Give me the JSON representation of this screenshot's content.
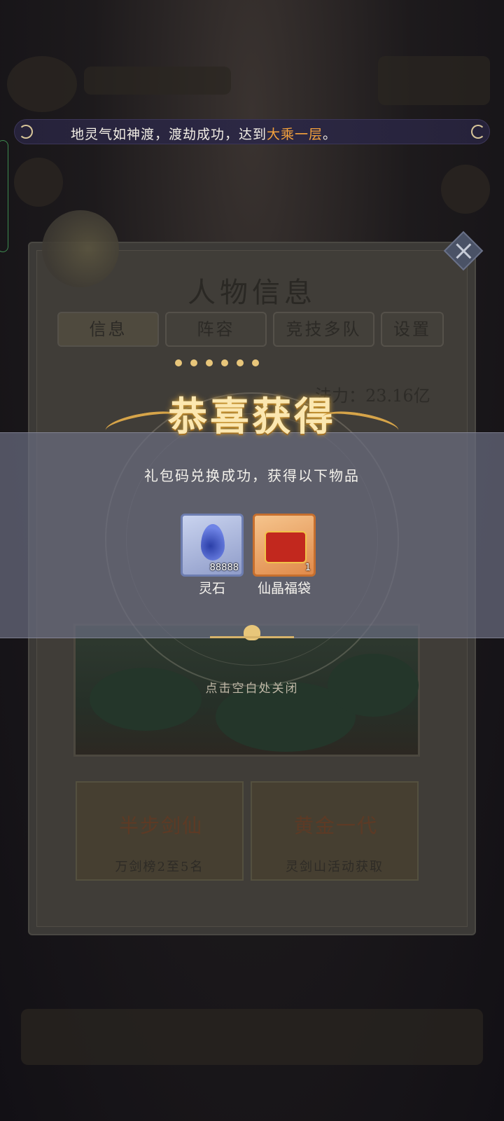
{
  "announcement": {
    "text_before": "地灵气如神渡，渡劫成功，达到",
    "highlight": "大乘一层",
    "text_after": "。",
    "highlight_color": "#f5a23c"
  },
  "panel": {
    "title": "人物信息",
    "tabs": [
      "信息",
      "阵容",
      "竞技多队",
      "设置"
    ],
    "power_label": "法力：23.16亿",
    "cards": [
      {
        "logo": "半步剑仙",
        "caption": "万剑榜2至5名"
      },
      {
        "logo": "黄金一代",
        "caption": "灵剑山活动获取"
      }
    ]
  },
  "reward_popup": {
    "title": "恭喜获得",
    "subtitle": "礼包码兑换成功，获得以下物品",
    "items": [
      {
        "name": "灵石",
        "count": "88888",
        "icon": "spirit-stone-icon"
      },
      {
        "name": "仙晶福袋",
        "count": "1",
        "icon": "lucky-bag-icon"
      }
    ],
    "close_hint": "点击空白处关闭"
  }
}
